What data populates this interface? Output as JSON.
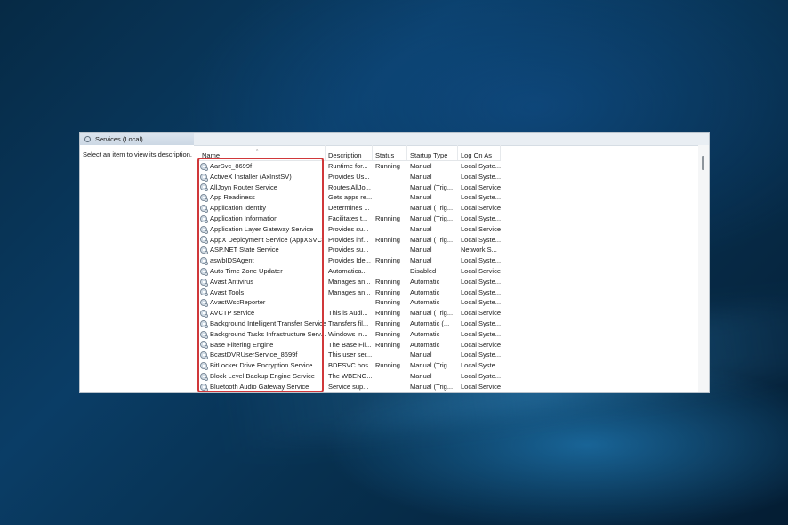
{
  "window": {
    "title": "Services (Local)"
  },
  "description_panel": {
    "hint": "Select an item to view its description."
  },
  "columns": {
    "name": "Name",
    "description": "Description",
    "status": "Status",
    "startup_type": "Startup Type",
    "log_on_as": "Log On As"
  },
  "rows": [
    {
      "name": "AarSvc_8699f",
      "description": "Runtime for...",
      "status": "Running",
      "startup": "Manual",
      "logon": "Local Syste..."
    },
    {
      "name": "ActiveX Installer (AxInstSV)",
      "description": "Provides Us...",
      "status": "",
      "startup": "Manual",
      "logon": "Local Syste..."
    },
    {
      "name": "AllJoyn Router Service",
      "description": "Routes AllJo...",
      "status": "",
      "startup": "Manual (Trig...",
      "logon": "Local Service"
    },
    {
      "name": "App Readiness",
      "description": "Gets apps re...",
      "status": "",
      "startup": "Manual",
      "logon": "Local Syste..."
    },
    {
      "name": "Application Identity",
      "description": "Determines ...",
      "status": "",
      "startup": "Manual (Trig...",
      "logon": "Local Service"
    },
    {
      "name": "Application Information",
      "description": "Facilitates t...",
      "status": "Running",
      "startup": "Manual (Trig...",
      "logon": "Local Syste..."
    },
    {
      "name": "Application Layer Gateway Service",
      "description": "Provides su...",
      "status": "",
      "startup": "Manual",
      "logon": "Local Service"
    },
    {
      "name": "AppX Deployment Service (AppXSVC)",
      "description": "Provides inf...",
      "status": "Running",
      "startup": "Manual (Trig...",
      "logon": "Local Syste..."
    },
    {
      "name": "ASP.NET State Service",
      "description": "Provides su...",
      "status": "",
      "startup": "Manual",
      "logon": "Network S..."
    },
    {
      "name": "aswbIDSAgent",
      "description": "Provides Ide...",
      "status": "Running",
      "startup": "Manual",
      "logon": "Local Syste..."
    },
    {
      "name": "Auto Time Zone Updater",
      "description": "Automatica...",
      "status": "",
      "startup": "Disabled",
      "logon": "Local Service"
    },
    {
      "name": "Avast Antivirus",
      "description": "Manages an...",
      "status": "Running",
      "startup": "Automatic",
      "logon": "Local Syste..."
    },
    {
      "name": "Avast Tools",
      "description": "Manages an...",
      "status": "Running",
      "startup": "Automatic",
      "logon": "Local Syste..."
    },
    {
      "name": "AvastWscReporter",
      "description": "",
      "status": "Running",
      "startup": "Automatic",
      "logon": "Local Syste..."
    },
    {
      "name": "AVCTP service",
      "description": "This is Audi...",
      "status": "Running",
      "startup": "Manual (Trig...",
      "logon": "Local Service"
    },
    {
      "name": "Background Intelligent Transfer Service",
      "description": "Transfers fil...",
      "status": "Running",
      "startup": "Automatic (...",
      "logon": "Local Syste..."
    },
    {
      "name": "Background Tasks Infrastructure Serv...",
      "description": "Windows in...",
      "status": "Running",
      "startup": "Automatic",
      "logon": "Local Syste..."
    },
    {
      "name": "Base Filtering Engine",
      "description": "The Base Fil...",
      "status": "Running",
      "startup": "Automatic",
      "logon": "Local Service"
    },
    {
      "name": "BcastDVRUserService_8699f",
      "description": "This user ser...",
      "status": "",
      "startup": "Manual",
      "logon": "Local Syste..."
    },
    {
      "name": "BitLocker Drive Encryption Service",
      "description": "BDESVC hos...",
      "status": "Running",
      "startup": "Manual (Trig...",
      "logon": "Local Syste..."
    },
    {
      "name": "Block Level Backup Engine Service",
      "description": "The WBENG...",
      "status": "",
      "startup": "Manual",
      "logon": "Local Syste..."
    },
    {
      "name": "Bluetooth Audio Gateway Service",
      "description": "Service sup...",
      "status": "",
      "startup": "Manual (Trig...",
      "logon": "Local Service"
    }
  ],
  "colors": {
    "highlight_box": "#d0383a",
    "desktop_blue": "#0a3d66"
  }
}
